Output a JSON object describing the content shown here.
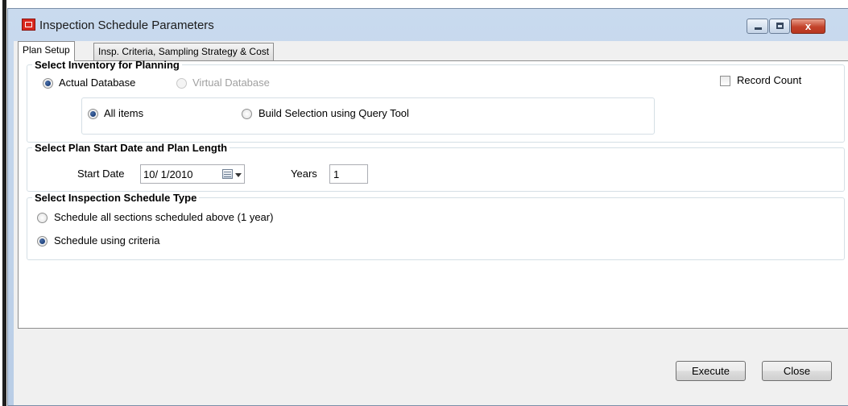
{
  "window": {
    "title": "Inspection Schedule Parameters",
    "close_glyph": "x",
    "icons": {
      "app": "app-icon",
      "minimize": "minimize-icon",
      "maximize": "maximize-icon",
      "close": "close-icon"
    }
  },
  "tabs": [
    {
      "label": "Plan Setup",
      "active": true
    },
    {
      "label": "Insp. Criteria, Sampling Strategy & Cost",
      "active": false
    }
  ],
  "inventory": {
    "legend": "Select Inventory for Planning",
    "actual_db_label": "Actual Database",
    "actual_db_selected": true,
    "virtual_db_label": "Virtual Database",
    "virtual_db_enabled": false,
    "record_count_label": "Record Count",
    "record_count_checked": false,
    "all_items_label": "All items",
    "all_items_selected": true,
    "build_selection_label": "Build Selection using Query Tool",
    "build_selection_selected": false
  },
  "plan_dates": {
    "legend": "Select Plan Start Date and Plan Length",
    "start_date_label": "Start Date",
    "start_date_value": "10/ 1/2010",
    "years_label": "Years",
    "years_value": "1"
  },
  "schedule_type": {
    "legend": "Select Inspection Schedule Type",
    "option_all_label": "Schedule all sections scheduled above (1 year)",
    "option_all_selected": false,
    "option_criteria_label": "Schedule using criteria",
    "option_criteria_selected": true
  },
  "buttons": {
    "execute": "Execute",
    "close": "Close"
  },
  "colors": {
    "close_button": "#c3432b",
    "title_bar": "#c9daee",
    "client_bg": "#f0f0f0"
  }
}
